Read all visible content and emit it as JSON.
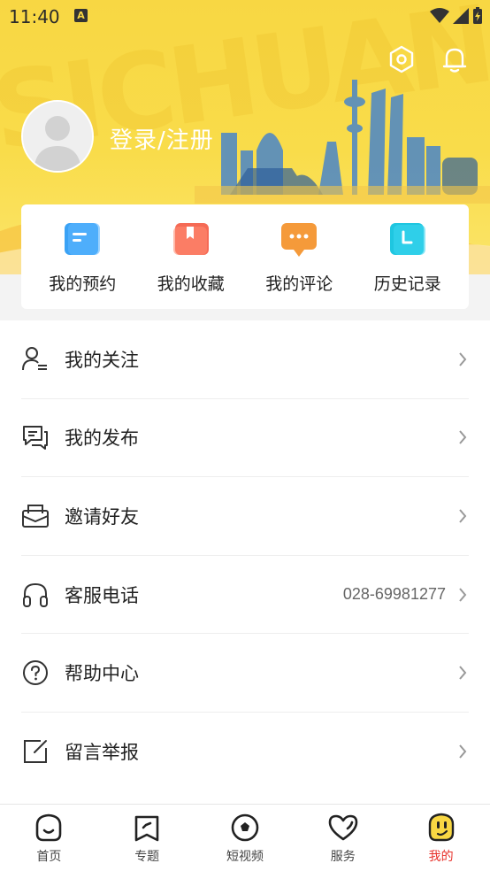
{
  "status_bar": {
    "time": "11:40",
    "badge": "A"
  },
  "header": {
    "login_label": "登录/注册",
    "watermark": "SICHUAN"
  },
  "shortcuts": [
    {
      "label": "我的预约",
      "icon": "calendar-icon",
      "color": "#3aa2f5"
    },
    {
      "label": "我的收藏",
      "icon": "bookmark-icon",
      "color": "#f56a55"
    },
    {
      "label": "我的评论",
      "icon": "comment-icon",
      "color": "#f59a3a"
    },
    {
      "label": "历史记录",
      "icon": "history-icon",
      "color": "#1fc6e0"
    }
  ],
  "menu": [
    {
      "label": "我的关注",
      "icon": "user-follow-icon",
      "value": ""
    },
    {
      "label": "我的发布",
      "icon": "publish-icon",
      "value": ""
    },
    {
      "label": "邀请好友",
      "icon": "invite-icon",
      "value": ""
    },
    {
      "label": "客服电话",
      "icon": "headphones-icon",
      "value": "028-69981277"
    },
    {
      "label": "帮助中心",
      "icon": "help-icon",
      "value": ""
    },
    {
      "label": "留言举报",
      "icon": "edit-report-icon",
      "value": ""
    }
  ],
  "tabs": [
    {
      "label": "首页",
      "icon": "home-icon",
      "active": false
    },
    {
      "label": "专题",
      "icon": "topic-icon",
      "active": false
    },
    {
      "label": "短视频",
      "icon": "video-icon",
      "active": false
    },
    {
      "label": "服务",
      "icon": "heart-icon",
      "active": false
    },
    {
      "label": "我的",
      "icon": "profile-face-icon",
      "active": true
    }
  ],
  "colors": {
    "header": "#f8d743",
    "active_tab": "#e8322b",
    "active_tab_icon": "#f8d743"
  }
}
